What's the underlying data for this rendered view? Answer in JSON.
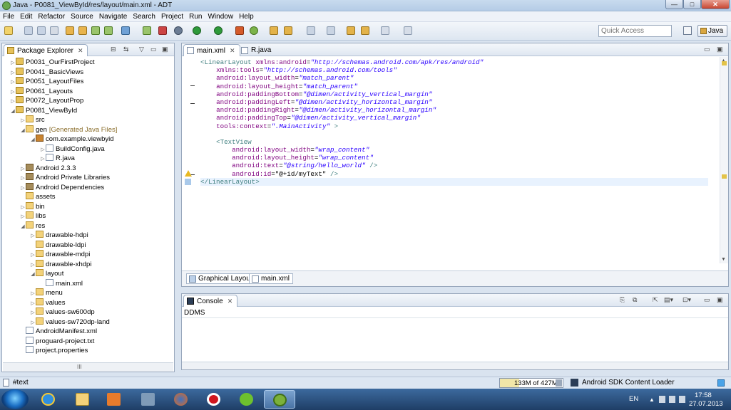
{
  "window": {
    "title": "Java - P0081_ViewById/res/layout/main.xml - ADT",
    "min": "—",
    "max": "□",
    "close": "✕"
  },
  "menu": [
    "File",
    "Edit",
    "Refactor",
    "Source",
    "Navigate",
    "Search",
    "Project",
    "Run",
    "Window",
    "Help"
  ],
  "toolbar": {
    "quick_access_placeholder": "Quick Access",
    "perspective_label": "Java"
  },
  "package_explorer": {
    "title": "Package Explorer",
    "items": [
      {
        "label": "P0031_OurFirstProject",
        "depth": 0,
        "twisty": "▷",
        "icon": "project"
      },
      {
        "label": "P0041_BasicViews",
        "depth": 0,
        "twisty": "▷",
        "icon": "project"
      },
      {
        "label": "P0051_LayoutFiles",
        "depth": 0,
        "twisty": "▷",
        "icon": "project"
      },
      {
        "label": "P0061_Layouts",
        "depth": 0,
        "twisty": "▷",
        "icon": "project"
      },
      {
        "label": "P0072_LayoutProp",
        "depth": 0,
        "twisty": "▷",
        "icon": "project"
      },
      {
        "label": "P0081_ViewById",
        "depth": 0,
        "twisty": "◢",
        "icon": "project"
      },
      {
        "label": "src",
        "depth": 1,
        "twisty": "▷",
        "icon": "folder"
      },
      {
        "label": "gen",
        "depth": 1,
        "twisty": "◢",
        "icon": "folder",
        "suffix": "[Generated Java Files]"
      },
      {
        "label": "com.example.viewbyid",
        "depth": 2,
        "twisty": "◢",
        "icon": "package"
      },
      {
        "label": "BuildConfig.java",
        "depth": 3,
        "twisty": "▷",
        "icon": "file"
      },
      {
        "label": "R.java",
        "depth": 3,
        "twisty": "▷",
        "icon": "file"
      },
      {
        "label": "Android 2.3.3",
        "depth": 1,
        "twisty": "▷",
        "icon": "library"
      },
      {
        "label": "Android Private Libraries",
        "depth": 1,
        "twisty": "▷",
        "icon": "library"
      },
      {
        "label": "Android Dependencies",
        "depth": 1,
        "twisty": "▷",
        "icon": "library"
      },
      {
        "label": "assets",
        "depth": 1,
        "twisty": "",
        "icon": "folder"
      },
      {
        "label": "bin",
        "depth": 1,
        "twisty": "▷",
        "icon": "folder"
      },
      {
        "label": "libs",
        "depth": 1,
        "twisty": "▷",
        "icon": "folder"
      },
      {
        "label": "res",
        "depth": 1,
        "twisty": "◢",
        "icon": "folder"
      },
      {
        "label": "drawable-hdpi",
        "depth": 2,
        "twisty": "▷",
        "icon": "folder"
      },
      {
        "label": "drawable-ldpi",
        "depth": 2,
        "twisty": "",
        "icon": "folder"
      },
      {
        "label": "drawable-mdpi",
        "depth": 2,
        "twisty": "▷",
        "icon": "folder"
      },
      {
        "label": "drawable-xhdpi",
        "depth": 2,
        "twisty": "▷",
        "icon": "folder"
      },
      {
        "label": "layout",
        "depth": 2,
        "twisty": "◢",
        "icon": "folder"
      },
      {
        "label": "main.xml",
        "depth": 3,
        "twisty": "",
        "icon": "xml"
      },
      {
        "label": "menu",
        "depth": 2,
        "twisty": "▷",
        "icon": "folder"
      },
      {
        "label": "values",
        "depth": 2,
        "twisty": "▷",
        "icon": "folder"
      },
      {
        "label": "values-sw600dp",
        "depth": 2,
        "twisty": "▷",
        "icon": "folder"
      },
      {
        "label": "values-sw720dp-land",
        "depth": 2,
        "twisty": "▷",
        "icon": "folder"
      },
      {
        "label": "AndroidManifest.xml",
        "depth": 1,
        "twisty": "",
        "icon": "xml"
      },
      {
        "label": "proguard-project.txt",
        "depth": 1,
        "twisty": "",
        "icon": "file"
      },
      {
        "label": "project.properties",
        "depth": 1,
        "twisty": "",
        "icon": "file"
      }
    ],
    "scroll_grip": "III"
  },
  "editor": {
    "tabs": [
      {
        "label": "main.xml",
        "active": true,
        "close": "✕"
      },
      {
        "label": "R.java",
        "active": false
      }
    ],
    "code_lines": [
      [
        [
          "tag",
          "<LinearLayout "
        ],
        [
          "att",
          "xmlns:android"
        ],
        [
          "txt",
          "="
        ],
        [
          "val",
          "\"http://schemas.android.com/apk/res/android\""
        ]
      ],
      [
        [
          "txt",
          "    "
        ],
        [
          "att",
          "xmlns:tools"
        ],
        [
          "txt",
          "="
        ],
        [
          "val",
          "\"http://schemas.android.com/tools\""
        ]
      ],
      [
        [
          "txt",
          "    "
        ],
        [
          "att",
          "android:layout_width"
        ],
        [
          "txt",
          "="
        ],
        [
          "val",
          "\"match_parent\""
        ]
      ],
      [
        [
          "txt",
          "    "
        ],
        [
          "att",
          "android:layout_height"
        ],
        [
          "txt",
          "="
        ],
        [
          "val",
          "\"match_parent\""
        ]
      ],
      [
        [
          "txt",
          "    "
        ],
        [
          "att",
          "android:paddingBottom"
        ],
        [
          "txt",
          "="
        ],
        [
          "val",
          "\"@dimen/activity_vertical_margin\""
        ]
      ],
      [
        [
          "txt",
          "    "
        ],
        [
          "att",
          "android:paddingLeft"
        ],
        [
          "txt",
          "="
        ],
        [
          "val",
          "\"@dimen/activity_horizontal_margin\""
        ]
      ],
      [
        [
          "txt",
          "    "
        ],
        [
          "att",
          "android:paddingRight"
        ],
        [
          "txt",
          "="
        ],
        [
          "val",
          "\"@dimen/activity_horizontal_margin\""
        ]
      ],
      [
        [
          "txt",
          "    "
        ],
        [
          "att",
          "android:paddingTop"
        ],
        [
          "txt",
          "="
        ],
        [
          "val",
          "\"@dimen/activity_vertical_margin\""
        ]
      ],
      [
        [
          "txt",
          "    "
        ],
        [
          "att",
          "tools:context"
        ],
        [
          "txt",
          "="
        ],
        [
          "val",
          "\".MainActivity\""
        ],
        [
          "tag",
          " >"
        ]
      ],
      [
        [
          "txt",
          ""
        ]
      ],
      [
        [
          "txt",
          "    "
        ],
        [
          "tag",
          "<TextView"
        ]
      ],
      [
        [
          "txt",
          "        "
        ],
        [
          "att",
          "android:layout_width"
        ],
        [
          "txt",
          "="
        ],
        [
          "val",
          "\"wrap_content\""
        ]
      ],
      [
        [
          "txt",
          "        "
        ],
        [
          "att",
          "android:layout_height"
        ],
        [
          "txt",
          "="
        ],
        [
          "val",
          "\"wrap_content\""
        ]
      ],
      [
        [
          "txt",
          "        "
        ],
        [
          "att",
          "android:text"
        ],
        [
          "txt",
          "="
        ],
        [
          "val",
          "\"@string/hello_world\""
        ],
        [
          "tag",
          " />"
        ]
      ],
      [
        [
          "txt",
          "        "
        ],
        [
          "att",
          "android:id"
        ],
        [
          "txt",
          "=\"@+id/myText\""
        ],
        [
          "tag",
          " />"
        ]
      ],
      [
        [
          "tag",
          "</LinearLayout>"
        ]
      ]
    ],
    "current_line": 15,
    "bottom_tabs": [
      "Graphical Layout",
      "main.xml"
    ],
    "warning_line": 15
  },
  "console": {
    "title": "Console",
    "content": "DDMS"
  },
  "status": {
    "left": "#text",
    "memory": "133M of 427M",
    "memory_used_fraction": 0.31,
    "loader": "Android SDK Content Loader"
  },
  "taskbar": {
    "lang": "EN",
    "time": "17:58",
    "date": "27.07.2013"
  },
  "colors": {
    "tag": "#3f7f7f",
    "attribute": "#7f007f",
    "value": "#2a00ff"
  }
}
